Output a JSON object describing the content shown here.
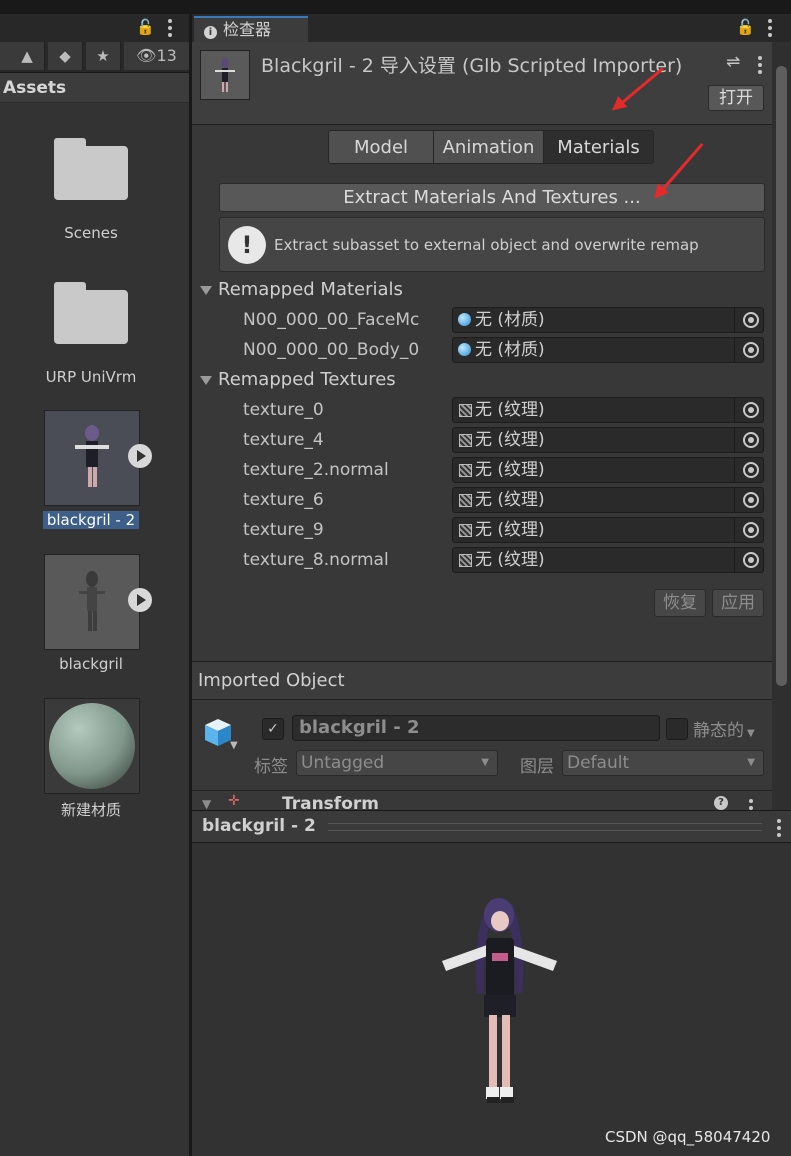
{
  "project": {
    "favorites_count": "13",
    "assets_header": "Assets",
    "items": [
      {
        "label": "Scenes",
        "type": "folder"
      },
      {
        "label": "URP UniVrm",
        "type": "folder"
      },
      {
        "label": "blackgril - 2",
        "type": "model",
        "selected": true
      },
      {
        "label": "blackgril",
        "type": "model"
      },
      {
        "label": "新建材质",
        "type": "material"
      }
    ]
  },
  "inspector": {
    "tab_label": "检查器",
    "title": "Blackgril - 2 导入设置 (Glb Scripted Importer)",
    "open_button": "打开",
    "tabs": [
      "Model",
      "Animation",
      "Materials"
    ],
    "active_tab": "Materials",
    "extract_button": "Extract Materials And Textures ...",
    "info_text": "Extract subasset to external object and overwrite remap",
    "remapped_materials_header": "Remapped Materials",
    "materials": [
      {
        "name": "N00_000_00_FaceMc",
        "value": "无 (材质)"
      },
      {
        "name": "N00_000_00_Body_0",
        "value": "无 (材质)"
      }
    ],
    "remapped_textures_header": "Remapped Textures",
    "textures": [
      {
        "name": "texture_0",
        "value": "无 (纹理)"
      },
      {
        "name": "texture_4",
        "value": "无 (纹理)"
      },
      {
        "name": "texture_2.normal",
        "value": "无 (纹理)"
      },
      {
        "name": "texture_6",
        "value": "无 (纹理)"
      },
      {
        "name": "texture_9",
        "value": "无 (纹理)"
      },
      {
        "name": "texture_8.normal",
        "value": "无 (纹理)"
      }
    ],
    "revert_button": "恢复",
    "apply_button": "应用",
    "imported_object_header": "Imported Object",
    "object_name": "blackgril - 2",
    "static_label": "静态的",
    "tag_label": "标签",
    "tag_value": "Untagged",
    "layer_label": "图层",
    "layer_value": "Default",
    "transform_label": "Transform"
  },
  "preview": {
    "title": "blackgril - 2"
  },
  "watermark": "CSDN @qq_58047420",
  "colors": {
    "annotation_arrow": "#e8292a",
    "tab_accent": "#3a79bb"
  }
}
